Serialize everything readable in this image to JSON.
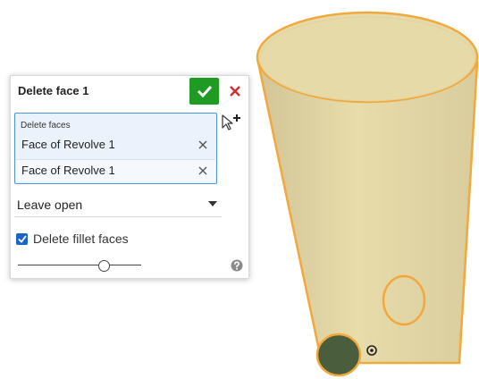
{
  "dialog": {
    "title": "Delete face 1",
    "ok_icon": "checkmark-icon",
    "cancel_icon": "close-icon",
    "faces_label": "Delete faces",
    "faces": [
      "Face of Revolve 1",
      "Face of Revolve 1"
    ],
    "remove_icon": "close-icon",
    "add_selection_icon": "cursor-add-icon",
    "mode_value": "Leave open",
    "fillet_label": "Delete fillet faces",
    "fillet_checked": true,
    "help_icon": "help-icon"
  },
  "colors": {
    "ok_green": "#1f9b24",
    "cancel_red": "#d32f2f",
    "selection_blue": "#4f95d6",
    "checkbox_blue": "#1c64c9",
    "model_fill": "#e6d9a6",
    "edge_orange": "#f2a83b",
    "hole_green": "#4a5e3e"
  }
}
